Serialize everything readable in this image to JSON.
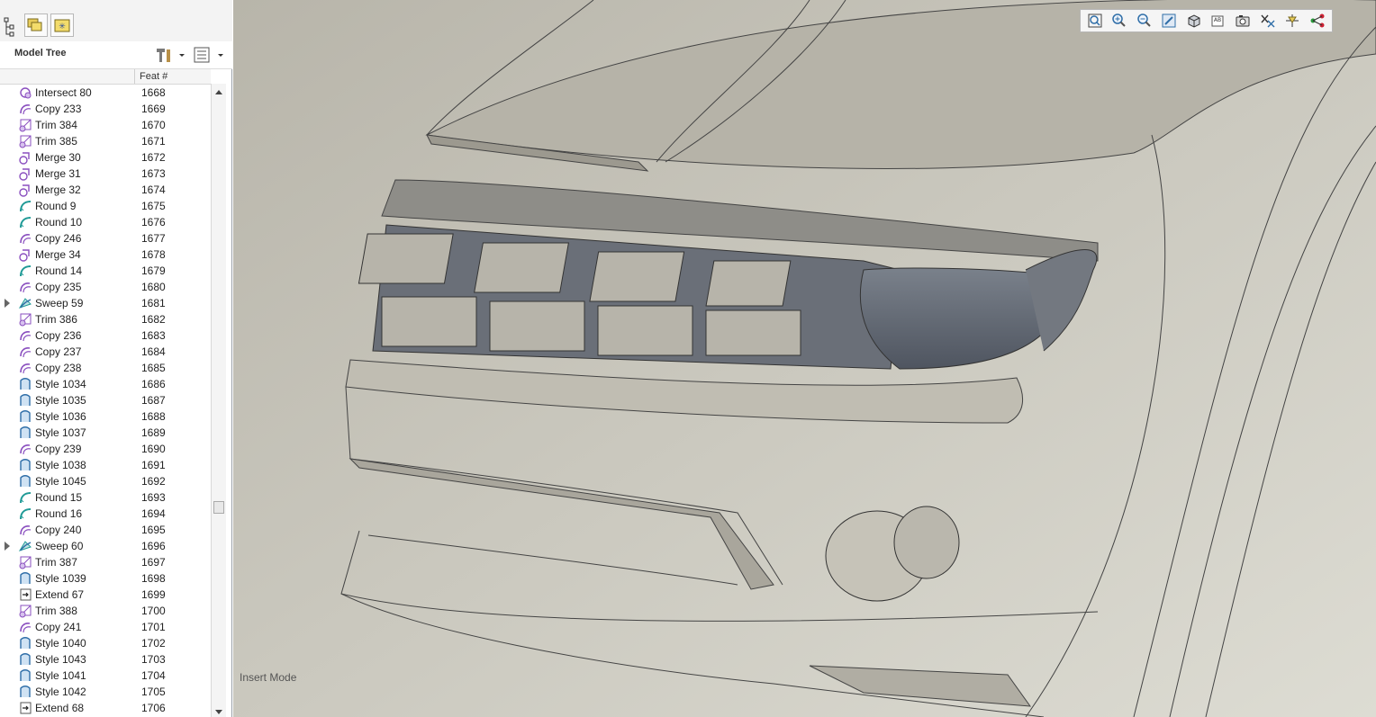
{
  "model_tree": {
    "title": "Model Tree",
    "column_header": "Feat #",
    "rows": [
      {
        "name": "Intersect 80",
        "num": "1668",
        "icon": "intersect-icon",
        "expandable": false
      },
      {
        "name": "Copy 233",
        "num": "1669",
        "icon": "copy-icon",
        "expandable": false
      },
      {
        "name": "Trim 384",
        "num": "1670",
        "icon": "trim-icon",
        "expandable": false
      },
      {
        "name": "Trim 385",
        "num": "1671",
        "icon": "trim-icon",
        "expandable": false
      },
      {
        "name": "Merge 30",
        "num": "1672",
        "icon": "merge-icon",
        "expandable": false
      },
      {
        "name": "Merge 31",
        "num": "1673",
        "icon": "merge-icon",
        "expandable": false
      },
      {
        "name": "Merge 32",
        "num": "1674",
        "icon": "merge-icon",
        "expandable": false
      },
      {
        "name": "Round 9",
        "num": "1675",
        "icon": "round-icon",
        "expandable": false
      },
      {
        "name": "Round 10",
        "num": "1676",
        "icon": "round-icon",
        "expandable": false
      },
      {
        "name": "Copy 246",
        "num": "1677",
        "icon": "copy-icon",
        "expandable": false
      },
      {
        "name": "Merge 34",
        "num": "1678",
        "icon": "merge-icon",
        "expandable": false
      },
      {
        "name": "Round 14",
        "num": "1679",
        "icon": "round-icon",
        "expandable": false
      },
      {
        "name": "Copy 235",
        "num": "1680",
        "icon": "copy-icon",
        "expandable": false
      },
      {
        "name": "Sweep 59",
        "num": "1681",
        "icon": "sweep-icon",
        "expandable": true
      },
      {
        "name": "Trim 386",
        "num": "1682",
        "icon": "trim-icon",
        "expandable": false
      },
      {
        "name": "Copy 236",
        "num": "1683",
        "icon": "copy-icon",
        "expandable": false
      },
      {
        "name": "Copy 237",
        "num": "1684",
        "icon": "copy-icon",
        "expandable": false
      },
      {
        "name": "Copy 238",
        "num": "1685",
        "icon": "copy-icon",
        "expandable": false
      },
      {
        "name": "Style 1034",
        "num": "1686",
        "icon": "style-icon",
        "expandable": false
      },
      {
        "name": "Style 1035",
        "num": "1687",
        "icon": "style-icon",
        "expandable": false
      },
      {
        "name": "Style 1036",
        "num": "1688",
        "icon": "style-icon",
        "expandable": false
      },
      {
        "name": "Style 1037",
        "num": "1689",
        "icon": "style-icon",
        "expandable": false
      },
      {
        "name": "Copy 239",
        "num": "1690",
        "icon": "copy-icon",
        "expandable": false
      },
      {
        "name": "Style 1038",
        "num": "1691",
        "icon": "style-icon",
        "expandable": false
      },
      {
        "name": "Style 1045",
        "num": "1692",
        "icon": "style-icon",
        "expandable": false
      },
      {
        "name": "Round 15",
        "num": "1693",
        "icon": "round-icon",
        "expandable": false
      },
      {
        "name": "Round 16",
        "num": "1694",
        "icon": "round-icon",
        "expandable": false
      },
      {
        "name": "Copy 240",
        "num": "1695",
        "icon": "copy-icon",
        "expandable": false
      },
      {
        "name": "Sweep 60",
        "num": "1696",
        "icon": "sweep-icon",
        "expandable": true
      },
      {
        "name": "Trim 387",
        "num": "1697",
        "icon": "trim-icon",
        "expandable": false
      },
      {
        "name": "Style 1039",
        "num": "1698",
        "icon": "style-icon",
        "expandable": false
      },
      {
        "name": "Extend 67",
        "num": "1699",
        "icon": "extend-icon",
        "expandable": false
      },
      {
        "name": "Trim 388",
        "num": "1700",
        "icon": "trim-icon",
        "expandable": false
      },
      {
        "name": "Copy 241",
        "num": "1701",
        "icon": "copy-icon",
        "expandable": false
      },
      {
        "name": "Style 1040",
        "num": "1702",
        "icon": "style-icon",
        "expandable": false
      },
      {
        "name": "Style 1043",
        "num": "1703",
        "icon": "style-icon",
        "expandable": false
      },
      {
        "name": "Style 1041",
        "num": "1704",
        "icon": "style-icon",
        "expandable": false
      },
      {
        "name": "Style 1042",
        "num": "1705",
        "icon": "style-icon",
        "expandable": false
      },
      {
        "name": "Extend 68",
        "num": "1706",
        "icon": "extend-icon",
        "expandable": false
      }
    ]
  },
  "view_toolbar": {
    "tools": [
      "refit-icon",
      "zoom-in-icon",
      "zoom-out-icon",
      "repaint-icon",
      "display-style-icon",
      "saved-orientations-icon",
      "screenshot-icon",
      "datum-display-icon",
      "spin-center-icon",
      "annotation-display-icon"
    ]
  },
  "viewport": {
    "status_text": "Insert Mode"
  },
  "colors": {
    "panel_bg": "#ffffff",
    "viewport_bg": "#c9c9c0",
    "lamp_dark": "#5d6169",
    "icon_purple": "#8a4fbf",
    "icon_blue": "#2f6ea8",
    "icon_teal": "#1f9a96"
  }
}
